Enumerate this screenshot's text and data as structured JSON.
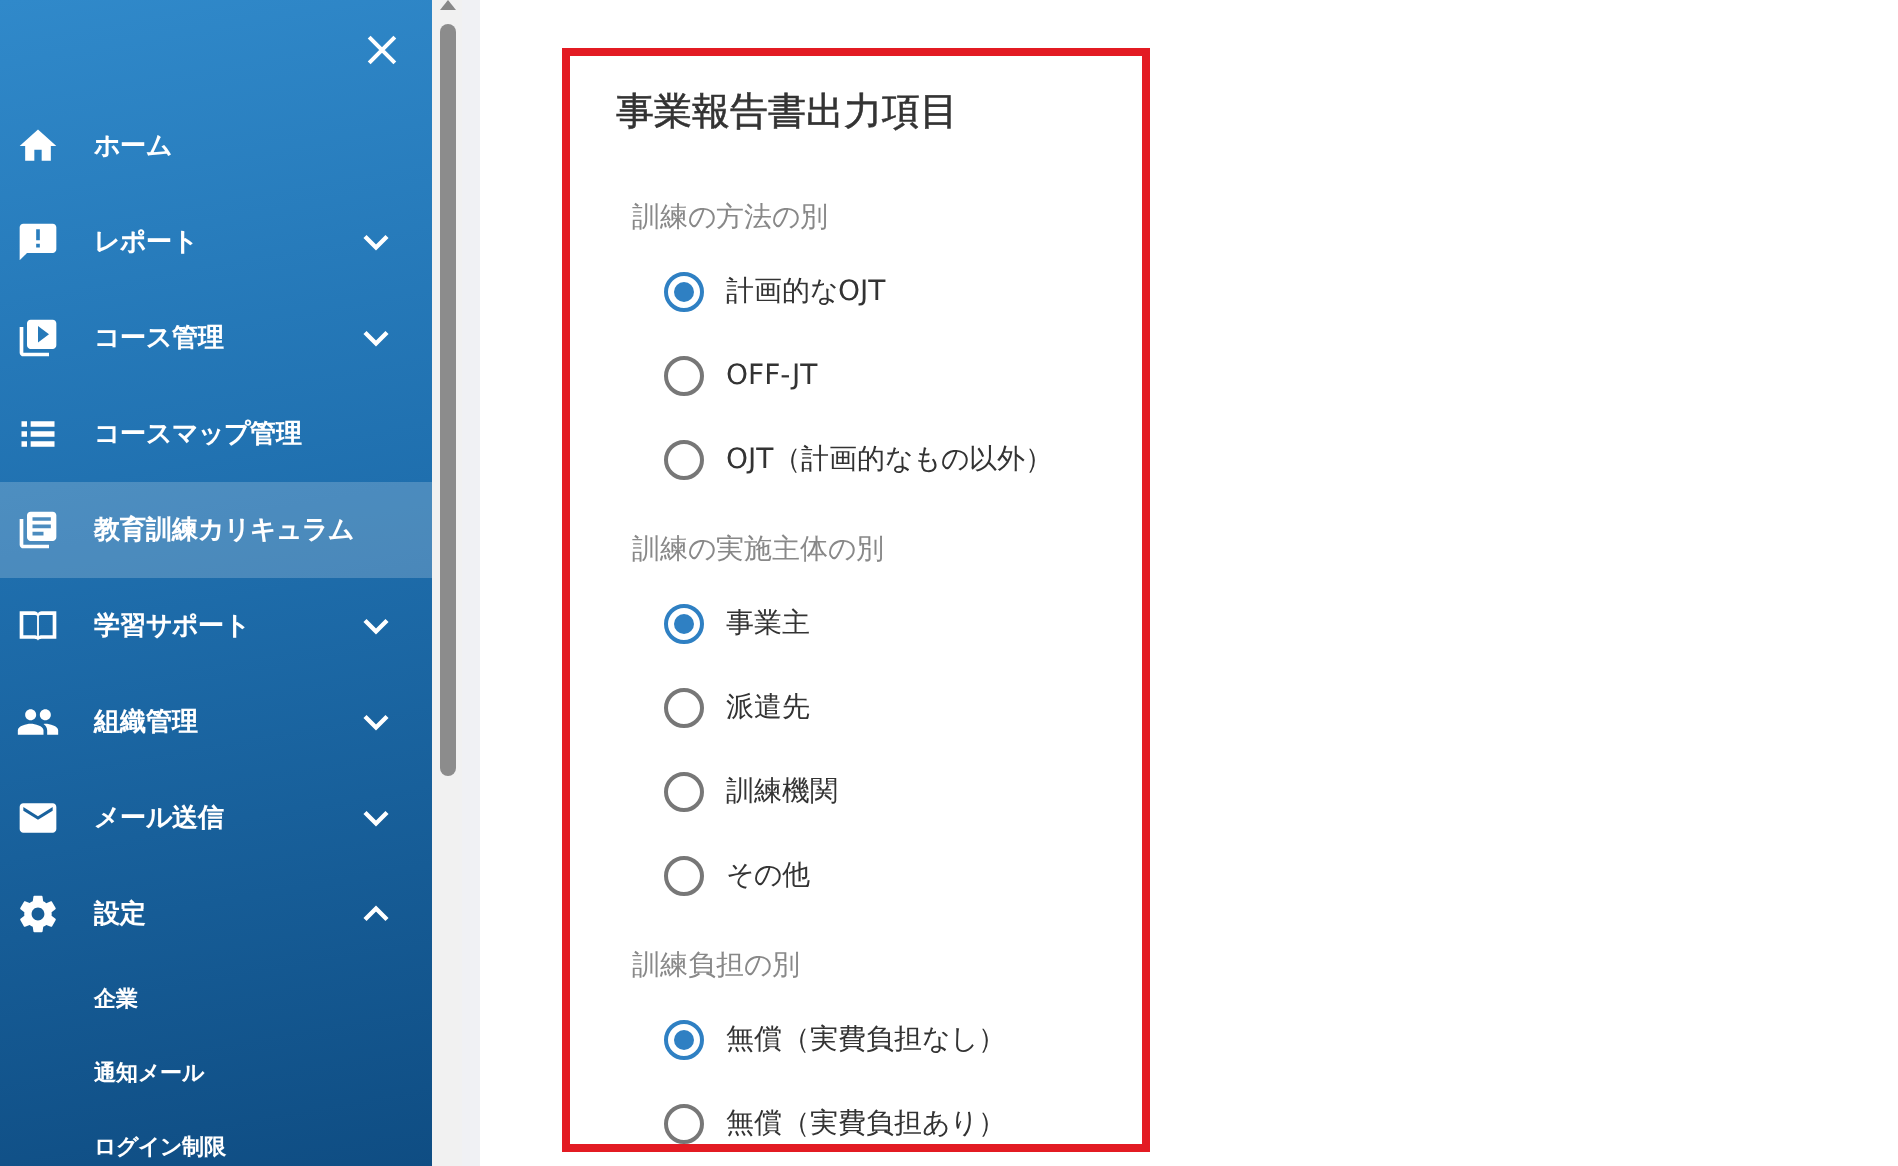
{
  "sidebar": {
    "items": [
      {
        "kind": "link",
        "label": "ホーム",
        "selected": false
      },
      {
        "kind": "group",
        "label": "レポート",
        "selected": false,
        "expanded": false
      },
      {
        "kind": "group",
        "label": "コース管理",
        "selected": false,
        "expanded": false
      },
      {
        "kind": "link",
        "label": "コースマップ管理",
        "selected": false
      },
      {
        "kind": "link",
        "label": "教育訓練カリキュラム",
        "selected": true
      },
      {
        "kind": "group",
        "label": "学習サポート",
        "selected": false,
        "expanded": false
      },
      {
        "kind": "group",
        "label": "組織管理",
        "selected": false,
        "expanded": false
      },
      {
        "kind": "group",
        "label": "メール送信",
        "selected": false,
        "expanded": false
      },
      {
        "kind": "group",
        "label": "設定",
        "selected": false,
        "expanded": true,
        "children": [
          {
            "label": "企業",
            "selected": false
          },
          {
            "label": "通知メール",
            "selected": false
          },
          {
            "label": "ログイン制限",
            "selected": false
          }
        ]
      }
    ]
  },
  "panel": {
    "title": "事業報告書出力項目",
    "sections": [
      {
        "label": "訓練の方法の別",
        "options": [
          {
            "label": "計画的なOJT",
            "selected": true
          },
          {
            "label": "OFF-JT",
            "selected": false
          },
          {
            "label": "OJT（計画的なもの以外）",
            "selected": false
          }
        ]
      },
      {
        "label": "訓練の実施主体の別",
        "options": [
          {
            "label": "事業主",
            "selected": true
          },
          {
            "label": "派遣先",
            "selected": false
          },
          {
            "label": "訓練機関",
            "selected": false
          },
          {
            "label": "その他",
            "selected": false
          }
        ]
      },
      {
        "label": "訓練負担の別",
        "options": [
          {
            "label": "無償（実費負担なし）",
            "selected": true
          },
          {
            "label": "無償（実費負担あり）",
            "selected": false
          }
        ]
      }
    ]
  }
}
